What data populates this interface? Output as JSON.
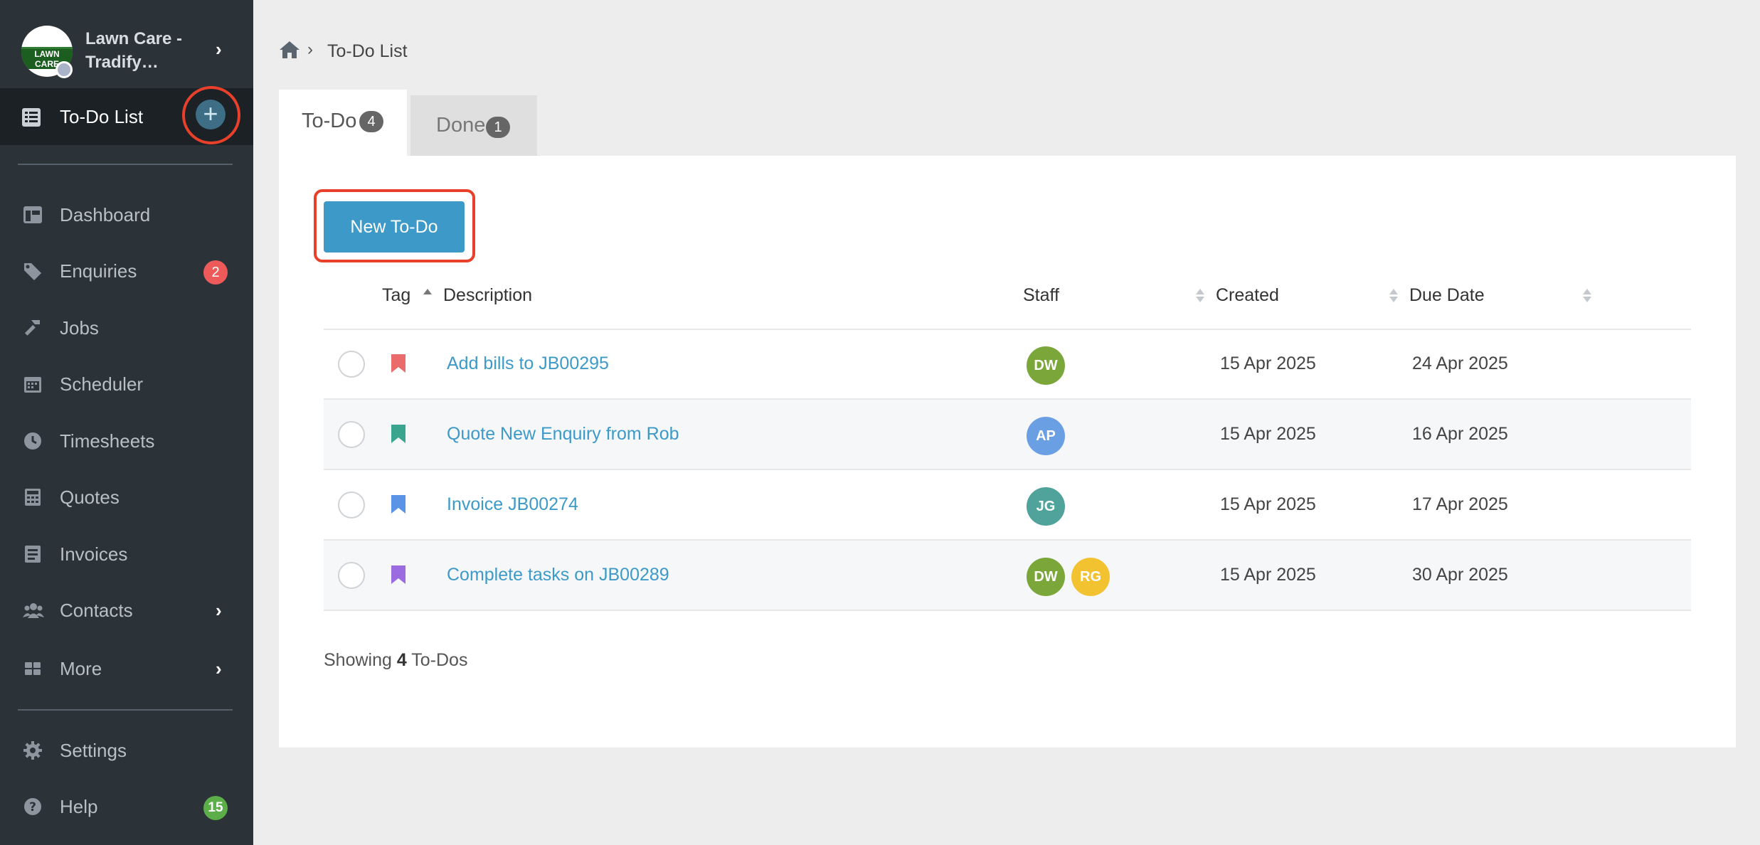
{
  "sidebar": {
    "org": {
      "logo_text": "LAWN CARE",
      "name_line1": "Lawn Care -",
      "name_line2": "Tradify…"
    },
    "todo_nav": {
      "label": "To-Do List",
      "add_icon": "plus-circle-icon"
    },
    "items": [
      {
        "label": "Dashboard",
        "icon": "dashboard-icon"
      },
      {
        "label": "Enquiries",
        "icon": "tags-icon",
        "badge": "2"
      },
      {
        "label": "Jobs",
        "icon": "hammer-icon"
      },
      {
        "label": "Scheduler",
        "icon": "calendar-icon"
      },
      {
        "label": "Timesheets",
        "icon": "clock-icon"
      },
      {
        "label": "Quotes",
        "icon": "calculator-icon"
      },
      {
        "label": "Invoices",
        "icon": "invoice-icon"
      },
      {
        "label": "Contacts",
        "icon": "users-icon"
      },
      {
        "label": "More",
        "icon": "grid-icon"
      },
      {
        "label": "Settings",
        "icon": "gear-icon"
      },
      {
        "label": "Help",
        "icon": "help-icon",
        "badge": "15"
      }
    ]
  },
  "breadcrumb": {
    "current": "To-Do List"
  },
  "tabs": [
    {
      "label": "To-Do",
      "count": "4",
      "active": true
    },
    {
      "label": "Done",
      "count": "1",
      "active": false
    }
  ],
  "toolbar": {
    "new_button": "New To-Do"
  },
  "table": {
    "headers": {
      "tag": "Tag",
      "description": "Description",
      "staff": "Staff",
      "created": "Created",
      "due": "Due Date"
    },
    "rows": [
      {
        "tag_color": "#e96b6b",
        "description": "Add bills to JB00295",
        "staff": [
          {
            "initials": "DW",
            "color": "#7aa63a"
          }
        ],
        "created": "15 Apr 2025",
        "due": "24 Apr 2025"
      },
      {
        "tag_color": "#3aa58e",
        "description": "Quote New Enquiry from Rob",
        "staff": [
          {
            "initials": "AP",
            "color": "#6b9fe3"
          }
        ],
        "created": "15 Apr 2025",
        "due": "16 Apr 2025"
      },
      {
        "tag_color": "#5b93e6",
        "description": "Invoice JB00274",
        "staff": [
          {
            "initials": "JG",
            "color": "#4fa39a"
          }
        ],
        "created": "15 Apr 2025",
        "due": "17 Apr 2025"
      },
      {
        "tag_color": "#9b6be0",
        "description": "Complete tasks on JB00289",
        "staff": [
          {
            "initials": "DW",
            "color": "#7aa63a"
          },
          {
            "initials": "RG",
            "color": "#f2c230"
          }
        ],
        "created": "15 Apr 2025",
        "due": "30 Apr 2025"
      }
    ]
  },
  "summary": {
    "prefix": "Showing",
    "count": "4",
    "suffix": "To-Dos"
  },
  "colors": {
    "sidebar_bg": "#2c3338",
    "accent": "#3d9ac8",
    "highlight_ring": "#e8402b"
  }
}
